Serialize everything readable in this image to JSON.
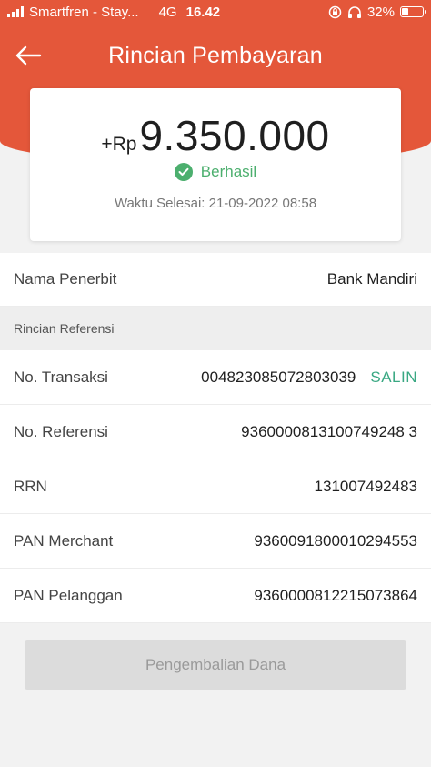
{
  "status_bar": {
    "carrier": "Smartfren - Stay...",
    "network": "4G",
    "time": "16.42",
    "battery": "32%",
    "battery_level": 0.32
  },
  "header": {
    "title": "Rincian Pembayaran"
  },
  "amount_card": {
    "prefix": "+Rp",
    "amount": "9.350.000",
    "status": "Berhasil",
    "completed_time": "Waktu Selesai: 21-09-2022 08:58"
  },
  "details": {
    "issuer_label": "Nama Penerbit",
    "issuer_value": "Bank Mandiri",
    "section_title": "Rincian Referensi",
    "transaction_label": "No. Transaksi",
    "transaction_value": "004823085072803039",
    "copy_label": "SALIN",
    "reference_label": "No. Referensi",
    "reference_value": "9360000813100749248 3",
    "rrn_label": "RRN",
    "rrn_value": "131007492483",
    "pan_merchant_label": "PAN Merchant",
    "pan_merchant_value": "9360091800010294553",
    "pan_customer_label": "PAN Pelanggan",
    "pan_customer_value": "9360000812215073864"
  },
  "footer": {
    "refund_label": "Pengembalian Dana"
  },
  "colors": {
    "header": "#e4573a",
    "success": "#4caf6e",
    "copy": "#3aa883"
  }
}
